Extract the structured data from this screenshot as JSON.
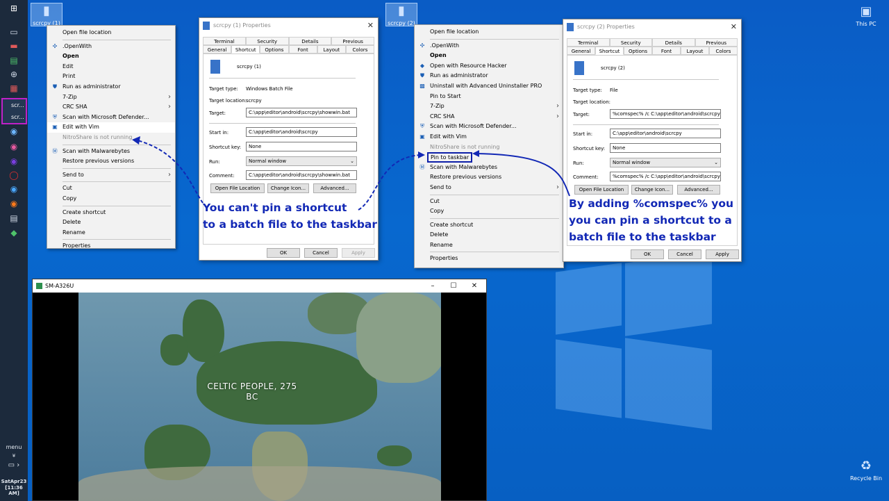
{
  "desktop": {
    "icons": [
      {
        "label": "scrcpy (1)"
      },
      {
        "label": "scrcpy (2)"
      },
      {
        "label": "This PC"
      },
      {
        "label": "Recycle Bin"
      }
    ]
  },
  "taskbar": {
    "group_items": [
      "scr...",
      "scr..."
    ],
    "menu_label": "menu",
    "clock_date": "SatApr23",
    "clock_time": "[11:36 AM]"
  },
  "menu1": {
    "items": [
      {
        "label": "Open file location"
      },
      {
        "label": ".OpenWith",
        "icon": "openwith-icon"
      },
      {
        "label": "Open",
        "bold": true
      },
      {
        "label": "Edit"
      },
      {
        "label": "Print"
      },
      {
        "label": "Run as administrator",
        "icon": "shield-icon"
      },
      {
        "label": "7-Zip",
        "arrow": true
      },
      {
        "label": "CRC SHA",
        "arrow": true
      },
      {
        "label": "Scan with Microsoft Defender...",
        "icon": "defender-icon"
      },
      {
        "label": "Edit with Vim",
        "icon": "vim-icon"
      },
      {
        "label": "NitroShare is not running",
        "disabled": true
      },
      {
        "label": "Scan with Malwarebytes",
        "icon": "malwarebytes-icon"
      },
      {
        "label": "Restore previous versions"
      },
      {
        "label": "Send to",
        "arrow": true
      },
      {
        "label": "Cut"
      },
      {
        "label": "Copy"
      },
      {
        "label": "Create shortcut"
      },
      {
        "label": "Delete"
      },
      {
        "label": "Rename"
      },
      {
        "label": "Properties"
      }
    ]
  },
  "menu2": {
    "items": [
      {
        "label": "Open file location"
      },
      {
        "label": ".OpenWith",
        "icon": "openwith-icon"
      },
      {
        "label": "Open",
        "bold": true
      },
      {
        "label": "Open with Resource Hacker",
        "icon": "reshacker-icon"
      },
      {
        "label": "Run as administrator",
        "icon": "shield-icon"
      },
      {
        "label": "Uninstall with Advanced Uninstaller PRO",
        "icon": "uninstaller-icon"
      },
      {
        "label": "Pin to Start"
      },
      {
        "label": "7-Zip",
        "arrow": true
      },
      {
        "label": "CRC SHA",
        "arrow": true
      },
      {
        "label": "Scan with Microsoft Defender...",
        "icon": "defender-icon"
      },
      {
        "label": "Edit with Vim",
        "icon": "vim-icon"
      },
      {
        "label": "NitroShare is not running",
        "disabled": true
      },
      {
        "label": "Pin to taskbar",
        "boxed": true
      },
      {
        "label": "Scan with Malwarebytes",
        "icon": "malwarebytes-icon"
      },
      {
        "label": "Restore previous versions"
      },
      {
        "label": "Send to",
        "arrow": true
      },
      {
        "label": "Cut"
      },
      {
        "label": "Copy"
      },
      {
        "label": "Create shortcut"
      },
      {
        "label": "Delete"
      },
      {
        "label": "Rename"
      },
      {
        "label": "Properties"
      }
    ]
  },
  "dialog1": {
    "title": "scrcpy (1) Properties",
    "tabs_top": [
      "Terminal",
      "Security",
      "Details",
      "Previous Versions"
    ],
    "tabs_bottom": [
      "General",
      "Shortcut",
      "Options",
      "Font",
      "Layout",
      "Colors"
    ],
    "name": "scrcpy (1)",
    "target_type_label": "Target type:",
    "target_type": "Windows Batch File",
    "target_location_label": "Target location:",
    "target_location": "scrcpy",
    "target_label": "Target:",
    "target": "C:\\app\\editor\\android\\scrcpy\\showwin.bat",
    "start_in_label": "Start in:",
    "start_in": "C:\\app\\editor\\android\\scrcpy",
    "shortcut_key_label": "Shortcut key:",
    "shortcut_key": "None",
    "run_label": "Run:",
    "run": "Normal window",
    "comment_label": "Comment:",
    "comment": "C:\\app\\editor\\android\\scrcpy\\showwin.bat",
    "open_file_location": "Open File Location",
    "change_icon": "Change Icon...",
    "advanced": "Advanced...",
    "ok": "OK",
    "cancel": "Cancel",
    "apply": "Apply"
  },
  "dialog2": {
    "title": "scrcpy (2) Properties",
    "tabs_top": [
      "Terminal",
      "Security",
      "Details",
      "Previous Versions"
    ],
    "tabs_bottom": [
      "General",
      "Shortcut",
      "Options",
      "Font",
      "Layout",
      "Colors"
    ],
    "name": "scrcpy (2)",
    "target_type_label": "Target type:",
    "target_type": "File",
    "target_location_label": "Target location:",
    "target_location": "",
    "target_label": "Target:",
    "target": "%comspec% /c C:\\app\\editor\\android\\scrcpy\\sho",
    "start_in_label": "Start in:",
    "start_in": "C:\\app\\editor\\android\\scrcpy",
    "shortcut_key_label": "Shortcut key:",
    "shortcut_key": "None",
    "run_label": "Run:",
    "run": "Normal window",
    "comment_label": "Comment:",
    "comment": "%comspec% /c C:\\app\\editor\\android\\scrcpy\\sho",
    "open_file_location": "Open File Location",
    "change_icon": "Change Icon...",
    "advanced": "Advanced...",
    "ok": "OK",
    "cancel": "Cancel",
    "apply": "Apply"
  },
  "annotations": {
    "left_line1": "You can't pin a shortcut",
    "left_line2": "to a batch file to the taskbar",
    "right_line1": "By adding  %comspec% you",
    "right_line2": "you can pin a shortcut to a",
    "right_line3": "batch file to the taskbar"
  },
  "phone_window": {
    "title": "SM-A326U",
    "minimize": "–",
    "maximize": "☐",
    "close": "✕",
    "map_text_line1": "CELTIC PEOPLE, 275",
    "map_text_line2": "BC"
  },
  "colors": {
    "accent_annotation": "#1228b5",
    "taskbar_highlight": "#c021c8"
  }
}
